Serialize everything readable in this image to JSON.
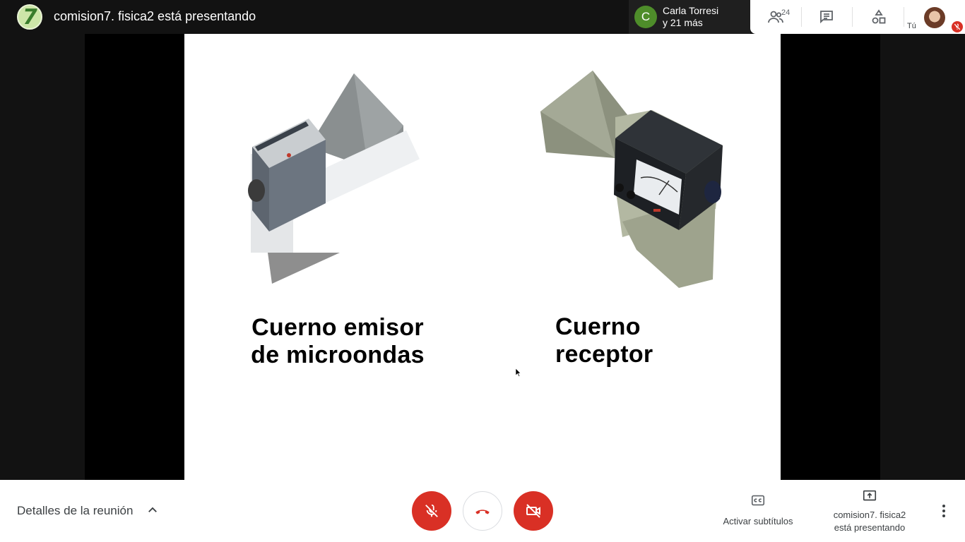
{
  "topbar": {
    "presenter_avatar_char": "7",
    "presenting_title": "comision7. fisica2 está presentando",
    "participant_chip": {
      "initial": "C",
      "name_line1": "Carla Torresi",
      "name_line2": "y 21 más"
    },
    "people_count": "24",
    "self_label": "Tú",
    "icons": [
      "people-icon",
      "chat-icon",
      "activities-icon",
      "mic-off-icon"
    ]
  },
  "slide": {
    "left_caption_line1": "Cuerno emisor",
    "left_caption_line2": "de microondas",
    "right_caption_line1": "Cuerno",
    "right_caption_line2": "receptor"
  },
  "bottombar": {
    "details_label": "Detalles de la reunión",
    "captions_label": "Activar subtítulos",
    "present_label_line1": "comision7. fisica2",
    "present_label_line2": "está presentando"
  },
  "colors": {
    "danger": "#d93025",
    "chip_avatar": "#4e8d2a",
    "stage_bg": "#000000",
    "bar_bg": "#121212"
  }
}
